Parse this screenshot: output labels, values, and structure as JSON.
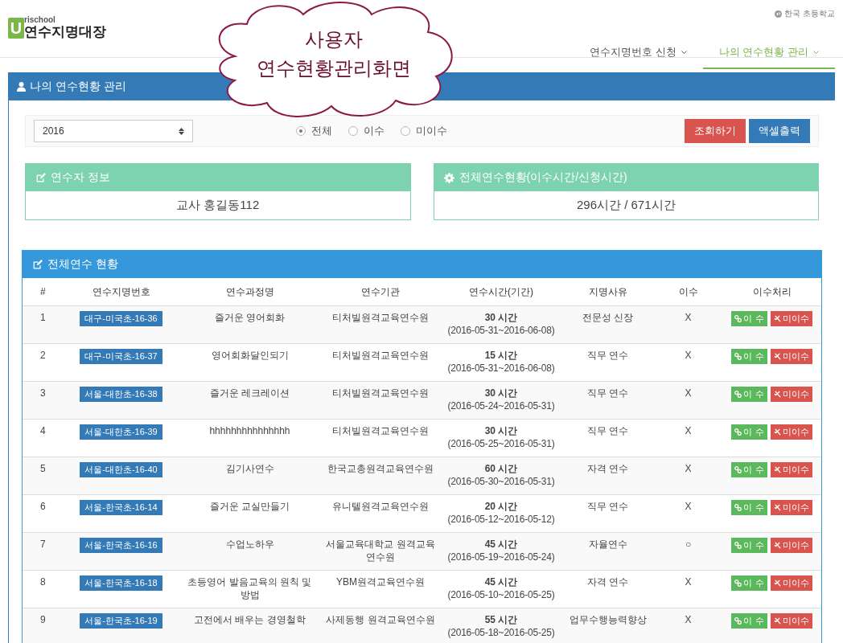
{
  "header": {
    "logo": {
      "mark": "U",
      "small": "rischool",
      "title": "연수지명대장"
    },
    "top_link": "한국 초등학교",
    "nav": [
      {
        "label": "연수지명번호 신청",
        "selected": false
      },
      {
        "label": "나의 연수현황 관리",
        "selected": true
      }
    ]
  },
  "callout": {
    "lines": [
      "사용자",
      "연수현황관리화면"
    ]
  },
  "panel": {
    "title": "나의 연수현황 관리",
    "filter": {
      "year": "2016",
      "radios": [
        {
          "label": "전체",
          "selected": true
        },
        {
          "label": "이수",
          "selected": false
        },
        {
          "label": "미이수",
          "selected": false
        }
      ],
      "buttons": [
        {
          "label": "조회하기",
          "kind": "danger"
        },
        {
          "label": "액셀출력",
          "kind": "primary"
        }
      ]
    },
    "info_cards": [
      {
        "kind": "edit",
        "title": "연수자 정보",
        "value": "교사 홍길동112"
      },
      {
        "kind": "gear",
        "title": "전체연수현황(이수시간/신청시간)",
        "value": "296시간 / 671시간"
      }
    ]
  },
  "table": {
    "title": "전체연수 현황",
    "columns": [
      "#",
      "연수지명번호",
      "연수과정명",
      "연수기관",
      "연수시간(기간)",
      "지명사유",
      "이수",
      "이수처리"
    ],
    "rows": [
      {
        "no": "1",
        "code": "대구-미국초-16-36",
        "course": "즐거운 영어회화",
        "institute": "티처빌원격교육연수원",
        "hours": "30 시간",
        "period": "(2016-05-31~2016-06-08)",
        "reason": "전문성 신장",
        "completed": "X",
        "actions": [
          "이 수",
          "미이수"
        ]
      },
      {
        "no": "2",
        "code": "대구-미국초-16-37",
        "course": "영어회화달인되기",
        "institute": "티처빌원격교육연수원",
        "hours": "15 시간",
        "period": "(2016-05-31~2016-06-08)",
        "reason": "직무 연수",
        "completed": "X",
        "actions": [
          "이 수",
          "미이수"
        ]
      },
      {
        "no": "3",
        "code": "서울-대한초-16-38",
        "course": "즐거운 레크레이션",
        "institute": "티처빌원격교육연수원",
        "hours": "30 시간",
        "period": "(2016-05-24~2016-05-31)",
        "reason": "직무 연수",
        "completed": "X",
        "actions": [
          "이 수",
          "미이수"
        ]
      },
      {
        "no": "4",
        "code": "서울-대한초-16-39",
        "course": "hhhhhhhhhhhhhhh",
        "institute": "티처빌원격교육연수원",
        "hours": "30 시간",
        "period": "(2016-05-25~2016-05-31)",
        "reason": "직무 연수",
        "completed": "X",
        "actions": [
          "이 수",
          "미이수"
        ]
      },
      {
        "no": "5",
        "code": "서울-대한초-16-40",
        "course": "김기사연수",
        "institute": "한국교총원격교육연수원",
        "hours": "60 시간",
        "period": "(2016-05-30~2016-05-31)",
        "reason": "자격 연수",
        "completed": "X",
        "actions": [
          "이 수",
          "미이수"
        ]
      },
      {
        "no": "6",
        "code": "서울-한국초-16-14",
        "course": "즐거운 교실만들기",
        "institute": "유니텔원격교육연수원",
        "hours": "20 시간",
        "period": "(2016-05-12~2016-05-12)",
        "reason": "직무 연수",
        "completed": "X",
        "actions": [
          "이 수",
          "미이수"
        ]
      },
      {
        "no": "7",
        "code": "서울-한국초-16-16",
        "course": "수업노하우",
        "institute": "서울교육대학교 원격교육연수원",
        "hours": "45 시간",
        "period": "(2016-05-19~2016-05-24)",
        "reason": "자율연수",
        "completed": "○",
        "actions": [
          "이 수",
          "미이수"
        ]
      },
      {
        "no": "8",
        "code": "서울-한국초-16-18",
        "course": "초등영어 발음교육의 원칙 및 방법",
        "institute": "YBM원격교육연수원",
        "hours": "45 시간",
        "period": "(2016-05-10~2016-05-25)",
        "reason": "자격 연수",
        "completed": "X",
        "actions": [
          "이 수",
          "미이수"
        ]
      },
      {
        "no": "9",
        "code": "서울-한국초-16-19",
        "course": "고전에서 배우는 경영철학",
        "institute": "사제동행 원격교육연수원",
        "hours": "55 시간",
        "period": "(2016-05-18~2016-05-25)",
        "reason": "업무수행능력향상",
        "completed": "X",
        "actions": [
          "이 수",
          "미이수"
        ]
      }
    ]
  }
}
